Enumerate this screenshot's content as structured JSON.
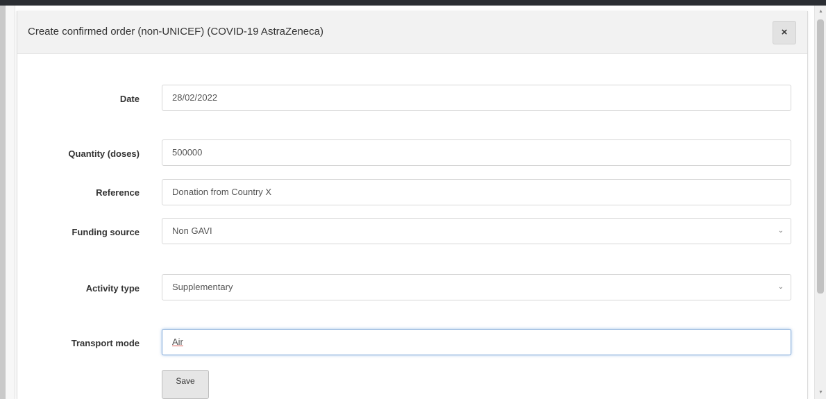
{
  "modal": {
    "title": "Create confirmed order (non-UNICEF) (COVID-19 AstraZeneca)",
    "close_label": "×"
  },
  "form": {
    "date": {
      "label": "Date",
      "value": "28/02/2022"
    },
    "quantity": {
      "label": "Quantity (doses)",
      "value": "500000"
    },
    "reference": {
      "label": "Reference",
      "value": "Donation from Country X"
    },
    "funding_source": {
      "label": "Funding source",
      "value": "Non GAVI"
    },
    "activity_type": {
      "label": "Activity type",
      "value": "Supplementary"
    },
    "transport_mode": {
      "label": "Transport mode",
      "value": "Air"
    },
    "save_label": "Save"
  },
  "icons": {
    "close": "close-icon",
    "select_chevron": "chevron-down-icon",
    "scroll_up": "scroll-up-arrow-icon",
    "scroll_down": "scroll-down-arrow-icon"
  },
  "colors": {
    "header_bg": "#f2f2f2",
    "focus_border": "#7fa8d8",
    "button_bg": "#e6e6e6"
  }
}
